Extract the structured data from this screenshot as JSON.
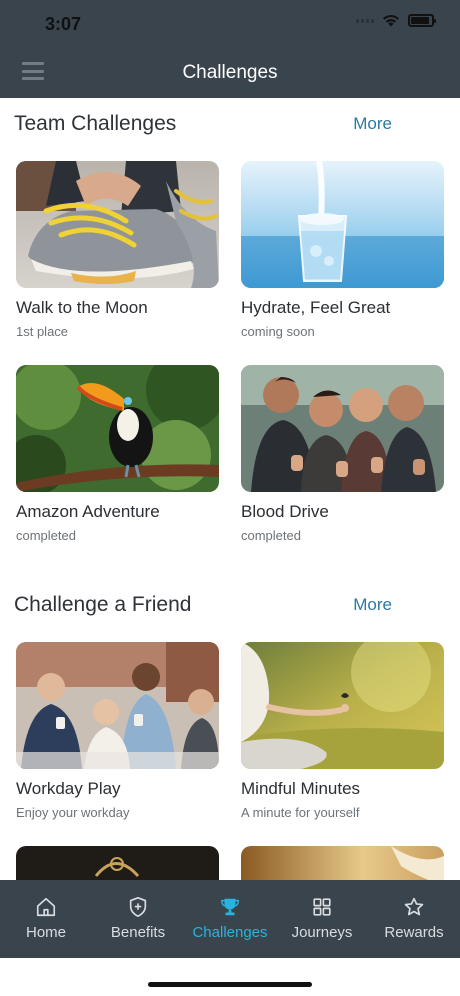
{
  "status_bar": {
    "time": "3:07"
  },
  "header": {
    "title": "Challenges",
    "menu_icon": "hamburger-icon"
  },
  "sections": [
    {
      "title": "Team Challenges",
      "more_label": "More",
      "cards": [
        {
          "name": "Walk to the Moon",
          "subtitle": "1st place",
          "image": "sneaker-lacing-photo"
        },
        {
          "name": "Hydrate, Feel Great",
          "subtitle": "coming soon",
          "image": "water-glass-photo"
        },
        {
          "name": "Amazon Adventure",
          "subtitle": "completed",
          "image": "toucan-photo"
        },
        {
          "name": "Blood Drive",
          "subtitle": "completed",
          "image": "group-thumbs-up-photo"
        }
      ]
    },
    {
      "title": "Challenge a Friend",
      "more_label": "More",
      "cards": [
        {
          "name": "Workday Play",
          "subtitle": "Enjoy your workday",
          "image": "coworkers-coffee-photo"
        },
        {
          "name": "Mindful Minutes",
          "subtitle": "A minute for yourself",
          "image": "meditation-field-photo"
        }
      ]
    }
  ],
  "tabs": [
    {
      "label": "Home",
      "icon": "home-icon",
      "active": false
    },
    {
      "label": "Benefits",
      "icon": "shield-plus-icon",
      "active": false
    },
    {
      "label": "Challenges",
      "icon": "trophy-icon",
      "active": true
    },
    {
      "label": "Journeys",
      "icon": "grid-icon",
      "active": false
    },
    {
      "label": "Rewards",
      "icon": "star-icon",
      "active": false
    }
  ],
  "colors": {
    "header_bg": "#3a444d",
    "accent": "#26b4e1",
    "link": "#2c78a7"
  }
}
